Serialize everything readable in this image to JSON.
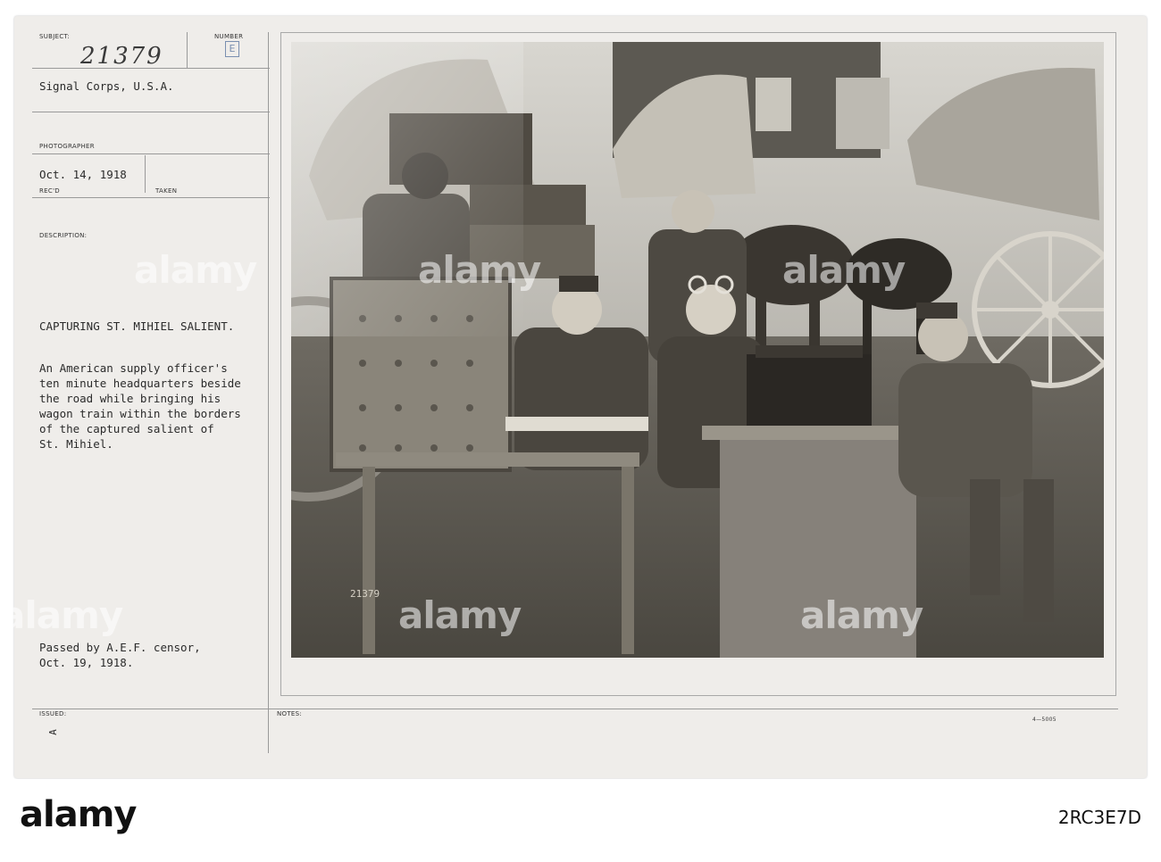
{
  "card": {
    "labels": {
      "subject": "SUBJECT:",
      "number": "NUMBER",
      "photographer": "PHOTOGRAPHER",
      "recd": "REC'D",
      "taken": "TAKEN",
      "description": "DESCRIPTION:",
      "issued": "ISSUED:",
      "notes": "NOTES:"
    },
    "subject_number": "21379",
    "number_letter": "E",
    "signal_corps": "Signal Corps, U.S.A.",
    "date_received": "Oct. 14, 1918",
    "title": "CAPTURING ST. MIHIEL SALIENT.",
    "description": [
      "An American supply officer's",
      "ten minute headquarters beside",
      "the road while bringing his",
      "wagon train within the borders",
      "of the captured salient of",
      "St. Mihiel."
    ],
    "censor": [
      "Passed by A.E.F. censor,",
      "Oct. 19, 1918."
    ],
    "issued_mark": "A",
    "form_number": "4—5005",
    "photo_number": "21379"
  },
  "watermark": "alamy",
  "footer": {
    "logo": "alamy",
    "image_id": "2RC3E7D"
  },
  "colors": {
    "card": "#efedea",
    "ink": "#2b2b2b",
    "stamp": "#7a8fb0"
  }
}
